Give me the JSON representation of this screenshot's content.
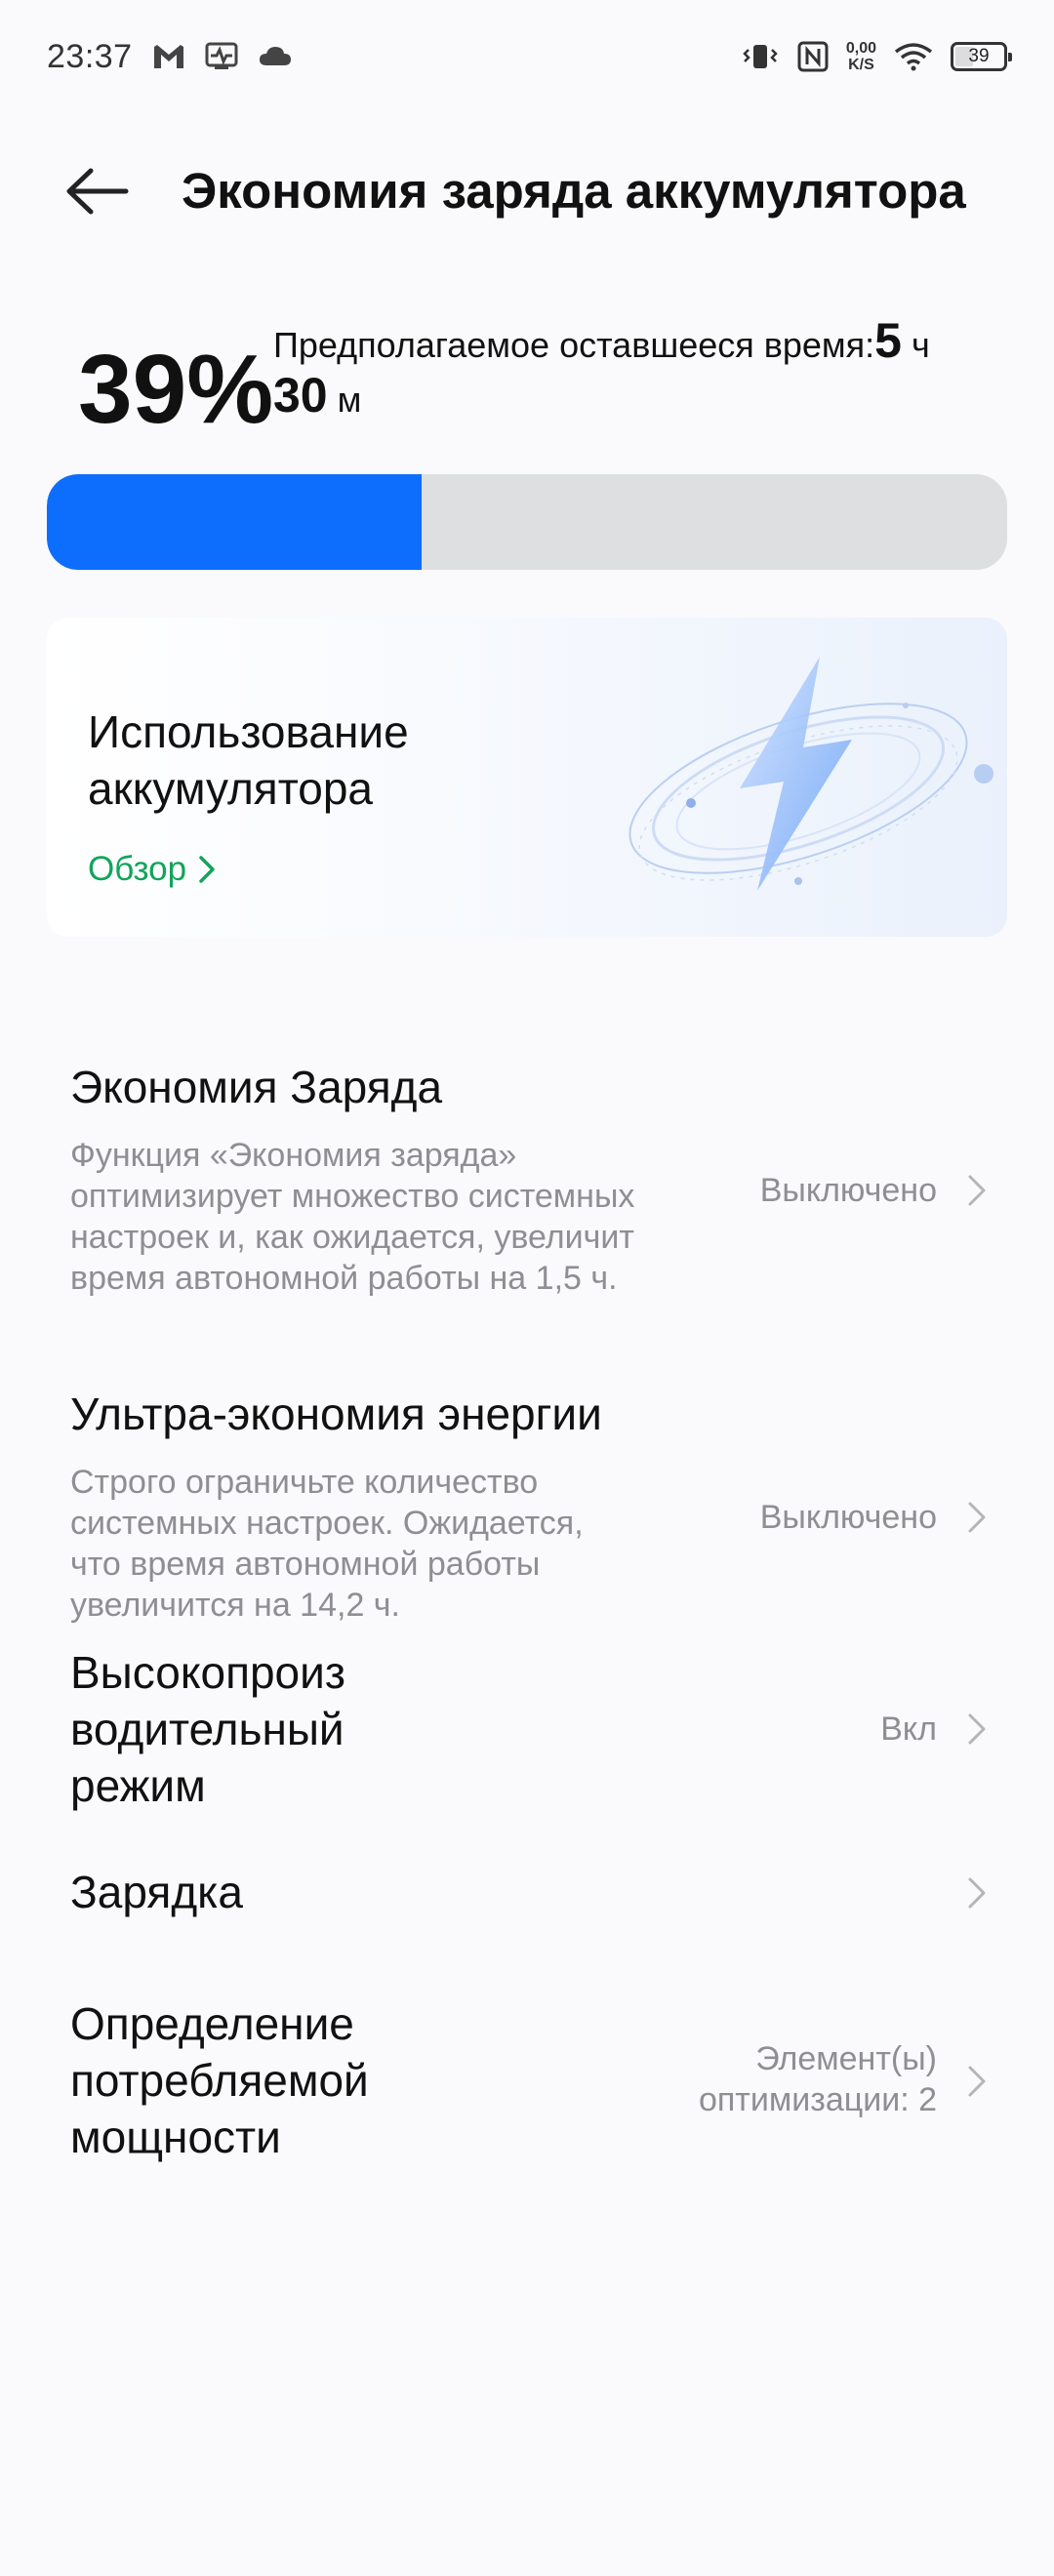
{
  "status_bar": {
    "time": "23:37",
    "left_icons": [
      "gmail-icon",
      "health-icon",
      "cloud-icon"
    ],
    "right_icons": [
      "vibrate-icon",
      "nfc-icon",
      "wifi-icon"
    ],
    "net_speed_value": "0,00",
    "net_speed_unit": "K/S",
    "battery_level": "39"
  },
  "header": {
    "back_icon": "arrow-left-icon",
    "title": "Экономия заряда аккумулятора"
  },
  "battery": {
    "percent_text": "39%",
    "percent_value": 39,
    "remaining_label": "Предполагаемое оставшееся время:",
    "hours_value": "5",
    "hours_unit": "ч",
    "minutes_value": "30",
    "minutes_unit": "м",
    "fill_color": "#0d6efd",
    "track_color": "#dedfe1"
  },
  "usage_card": {
    "title_line1": "Использование",
    "title_line2": "аккумулятора",
    "link_label": "Обзор",
    "link_color": "#12a45a",
    "illustration": "lightning-bolt-icon"
  },
  "settings": [
    {
      "title": "Экономия Заряда",
      "desc_lines": [
        "Функция «Экономия заряда»",
        "оптимизирует множество системных",
        "настроек и, как ожидается, увеличит",
        "время автономной работы на 1,5 ч."
      ],
      "value": "Выключено"
    },
    {
      "title": "Ультра-экономия энергии",
      "desc_lines": [
        "Строго ограничьте количество",
        "системных настроек. Ожидается,",
        "что время автономной работы",
        "увеличится на 14,2 ч."
      ],
      "value": "Выключено"
    },
    {
      "title_lines": [
        "Высокопроиз",
        "водительный",
        "режим"
      ],
      "value": "Вкл"
    },
    {
      "title": "Зарядка",
      "value": ""
    },
    {
      "title_lines": [
        "Определение",
        "потребляемой",
        "мощности"
      ],
      "value_lines": [
        "Элемент(ы)",
        "оптимизации: 2"
      ]
    }
  ]
}
